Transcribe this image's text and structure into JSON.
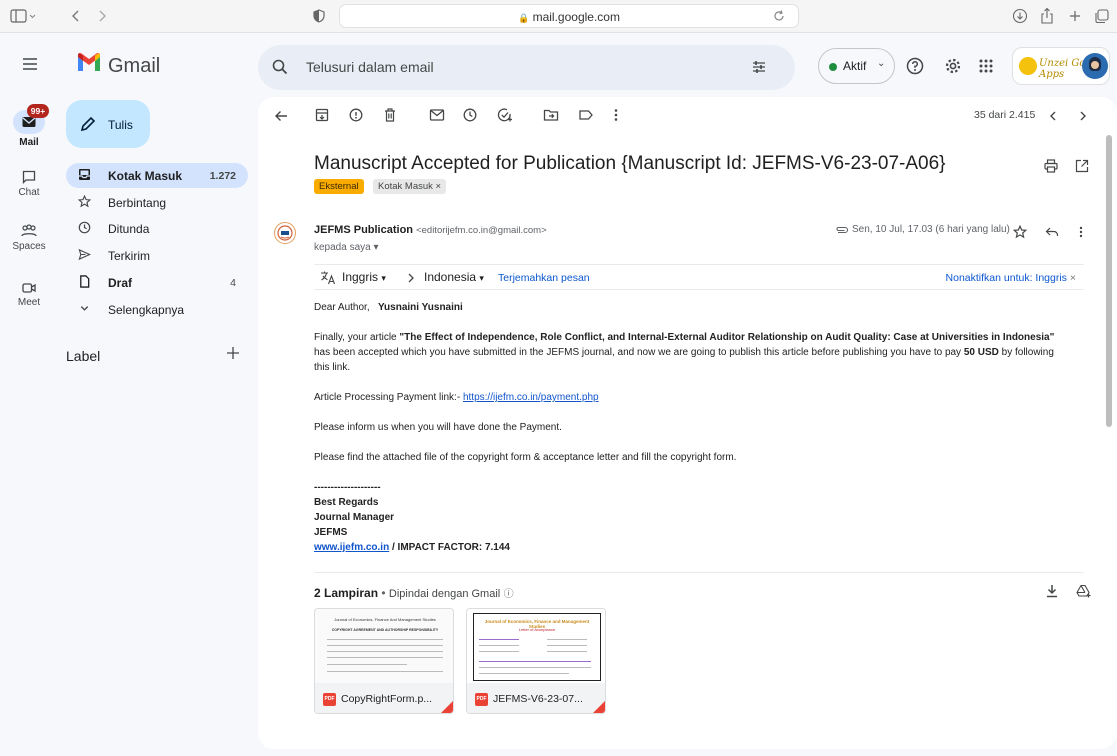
{
  "browser": {
    "url": "mail.google.com"
  },
  "app": {
    "name": "Gmail"
  },
  "search": {
    "placeholder": "Telusuri dalam email"
  },
  "status": {
    "label": "Aktif"
  },
  "org_logo_text": "Unzei Google Apps",
  "rail": [
    {
      "label": "Mail",
      "badge": "99+"
    },
    {
      "label": "Chat"
    },
    {
      "label": "Spaces"
    },
    {
      "label": "Meet"
    }
  ],
  "compose": {
    "label": "Tulis"
  },
  "nav": [
    {
      "label": "Kotak Masuk",
      "count": "1.272",
      "icon": "inbox-icon"
    },
    {
      "label": "Berbintang",
      "count": "",
      "icon": "star-icon"
    },
    {
      "label": "Ditunda",
      "count": "",
      "icon": "clock-icon"
    },
    {
      "label": "Terkirim",
      "count": "",
      "icon": "send-icon"
    },
    {
      "label": "Draf",
      "count": "4",
      "icon": "file-icon"
    },
    {
      "label": "Selengkapnya",
      "count": "",
      "icon": "chevron-down-icon"
    }
  ],
  "labels": {
    "header": "Label"
  },
  "toolbar": {
    "count_text": "35 dari 2.415"
  },
  "email": {
    "subject": "Manuscript Accepted for Publication {Manuscript Id: JEFMS-V6-23-07-A06}",
    "tags": [
      "Eksternal",
      "Kotak Masuk ×"
    ],
    "sender_name": "JEFMS Publication",
    "sender_email": "<editorijefm.co.in@gmail.com>",
    "to": "kepada saya ▾",
    "date": "Sen, 10 Jul, 17.03 (6 hari yang lalu)",
    "translate": {
      "from": "Inggris",
      "to": "Indonesia",
      "link": "Terjemahkan pesan",
      "off": "Nonaktifkan untuk: Inggris"
    },
    "body": {
      "greeting": "Dear Author,",
      "author": "Yusnaini Yusnaini",
      "p1_a": "Finally, your article ",
      "p1_title": "\"The Effect of Independence, Role Conflict, and Internal-External Auditor Relationship on Audit Quality: Case at Universities in Indonesia\"",
      "p1_b": " has been accepted which you have submitted in the JEFMS journal, and now we are going to publish this article before publishing you have to pay ",
      "p1_amount": "50 USD",
      "p1_c": " by following this link.",
      "p2_a": "Article Processing Payment link:- ",
      "p2_link": "https://ijefm.co.in/payment.php",
      "p3": "Please inform us when you will have done the Payment.",
      "p4": "Please find the attached file of the copyright form & acceptance letter and fill the copyright form.",
      "sig_dash": "--------------------",
      "sig1": "Best Regards",
      "sig2": "Journal Manager",
      "sig3": "JEFMS",
      "sig_link": "www.ijefm.co.in",
      "sig_impact": " / IMPACT FACTOR: 7.144"
    },
    "attachments_header": "2 Lampiran",
    "attachments_scan": "Dipindai dengan Gmail",
    "attachments": [
      {
        "name": "CopyRightForm.p...",
        "preview_title": "Journal of Economics, Finance And Management Studies",
        "preview_sub": "COPYRIGHT AGREEMENT AND AUTHORSHIP RESPONSIBILITY"
      },
      {
        "name": "JEFMS-V6-23-07...",
        "preview_title": "Journal of Economics, Finance and Management Studies",
        "preview_sub": "Letter of Acceptance"
      }
    ]
  }
}
